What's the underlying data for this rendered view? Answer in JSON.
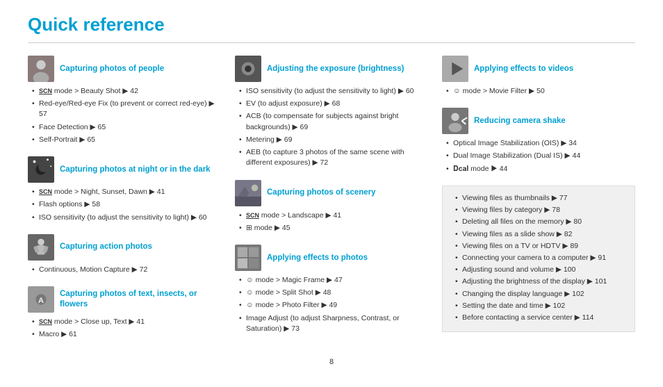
{
  "title": "Quick reference",
  "page_number": "8",
  "columns": [
    {
      "id": "col1",
      "sections": [
        {
          "id": "capturing-people",
          "title": "Capturing photos of people",
          "img_label": "people-photo",
          "img_color": "#8a7a7a",
          "items": [
            "SCN mode > Beauty Shot ▶ 42",
            "Red-eye/Red-eye Fix (to prevent or correct red-eye) ▶ 57",
            "Face Detection ▶ 65",
            "Self-Portrait ▶ 65"
          ]
        },
        {
          "id": "capturing-night",
          "title": "Capturing photos at night or in the dark",
          "img_label": "night-photo",
          "img_color": "#555555",
          "items": [
            "SCN mode > Night, Sunset, Dawn ▶ 41",
            "Flash options ▶ 58",
            "ISO sensitivity (to adjust the sensitivity to light) ▶ 60"
          ]
        },
        {
          "id": "capturing-action",
          "title": "Capturing action photos",
          "img_label": "action-photo",
          "img_color": "#666666",
          "items": [
            "Continuous, Motion Capture ▶ 72"
          ]
        },
        {
          "id": "capturing-text",
          "title": "Capturing photos of text, insects, or flowers",
          "img_label": "text-insects-photo",
          "img_color": "#aaaaaa",
          "items": [
            "SCN mode > Close up, Text ▶ 41",
            "Macro ▶ 61"
          ]
        }
      ]
    },
    {
      "id": "col2",
      "sections": [
        {
          "id": "adjusting-exposure",
          "title": "Adjusting the exposure (brightness)",
          "img_label": "exposure-photo",
          "img_color": "#666666",
          "items": [
            "ISO sensitivity (to adjust the sensitivity to light) ▶ 60",
            "EV (to adjust exposure) ▶ 68",
            "ACB (to compensate for subjects against bright backgrounds) ▶ 69",
            "Metering ▶ 69",
            "AEB (to capture 3 photos of the same scene with different exposures) ▶ 72"
          ]
        },
        {
          "id": "capturing-scenery",
          "title": "Capturing photos of scenery",
          "img_label": "scenery-photo",
          "img_color": "#999999",
          "items": [
            "SCN mode > Landscape ▶ 41",
            "⊞ mode ▶ 45"
          ]
        },
        {
          "id": "applying-effects-photos",
          "title": "Applying effects to photos",
          "img_label": "effects-photo",
          "img_color": "#888888",
          "items": [
            "✿ mode > Magic Frame ▶ 47",
            "✿ mode > Split Shot ▶ 48",
            "✿ mode > Photo Filter ▶ 49",
            "Image Adjust (to adjust Sharpness, Contrast, or Saturation) ▶ 73"
          ]
        }
      ]
    },
    {
      "id": "col3",
      "sections": [
        {
          "id": "applying-effects-videos",
          "title": "Applying effects to videos",
          "img_label": "effects-video",
          "img_color": "#aaaaaa",
          "items": [
            "✿ mode > Movie Filter ▶ 50"
          ]
        },
        {
          "id": "reducing-shake",
          "title": "Reducing camera shake",
          "img_label": "camera-shake",
          "img_color": "#777777",
          "items": [
            "Optical Image Stabilization (OIS) ▶ 34",
            "Dual Image Stabilization (Dual IS) ▶ 44",
            "DUAL mode ▶ 44"
          ]
        }
      ],
      "info_box": {
        "items": [
          "Viewing files as thumbnails ▶ 77",
          "Viewing files by category ▶ 78",
          "Deleting all files on the memory ▶ 80",
          "Viewing files as a slide show ▶ 82",
          "Viewing files on a TV or HDTV ▶ 89",
          "Connecting your camera to a computer ▶ 91",
          "Adjusting sound and volume ▶ 100",
          "Adjusting the brightness of the display ▶ 101",
          "Changing the display language ▶ 102",
          "Setting the date and time ▶ 102",
          "Before contacting a service center ▶ 114"
        ]
      }
    }
  ]
}
